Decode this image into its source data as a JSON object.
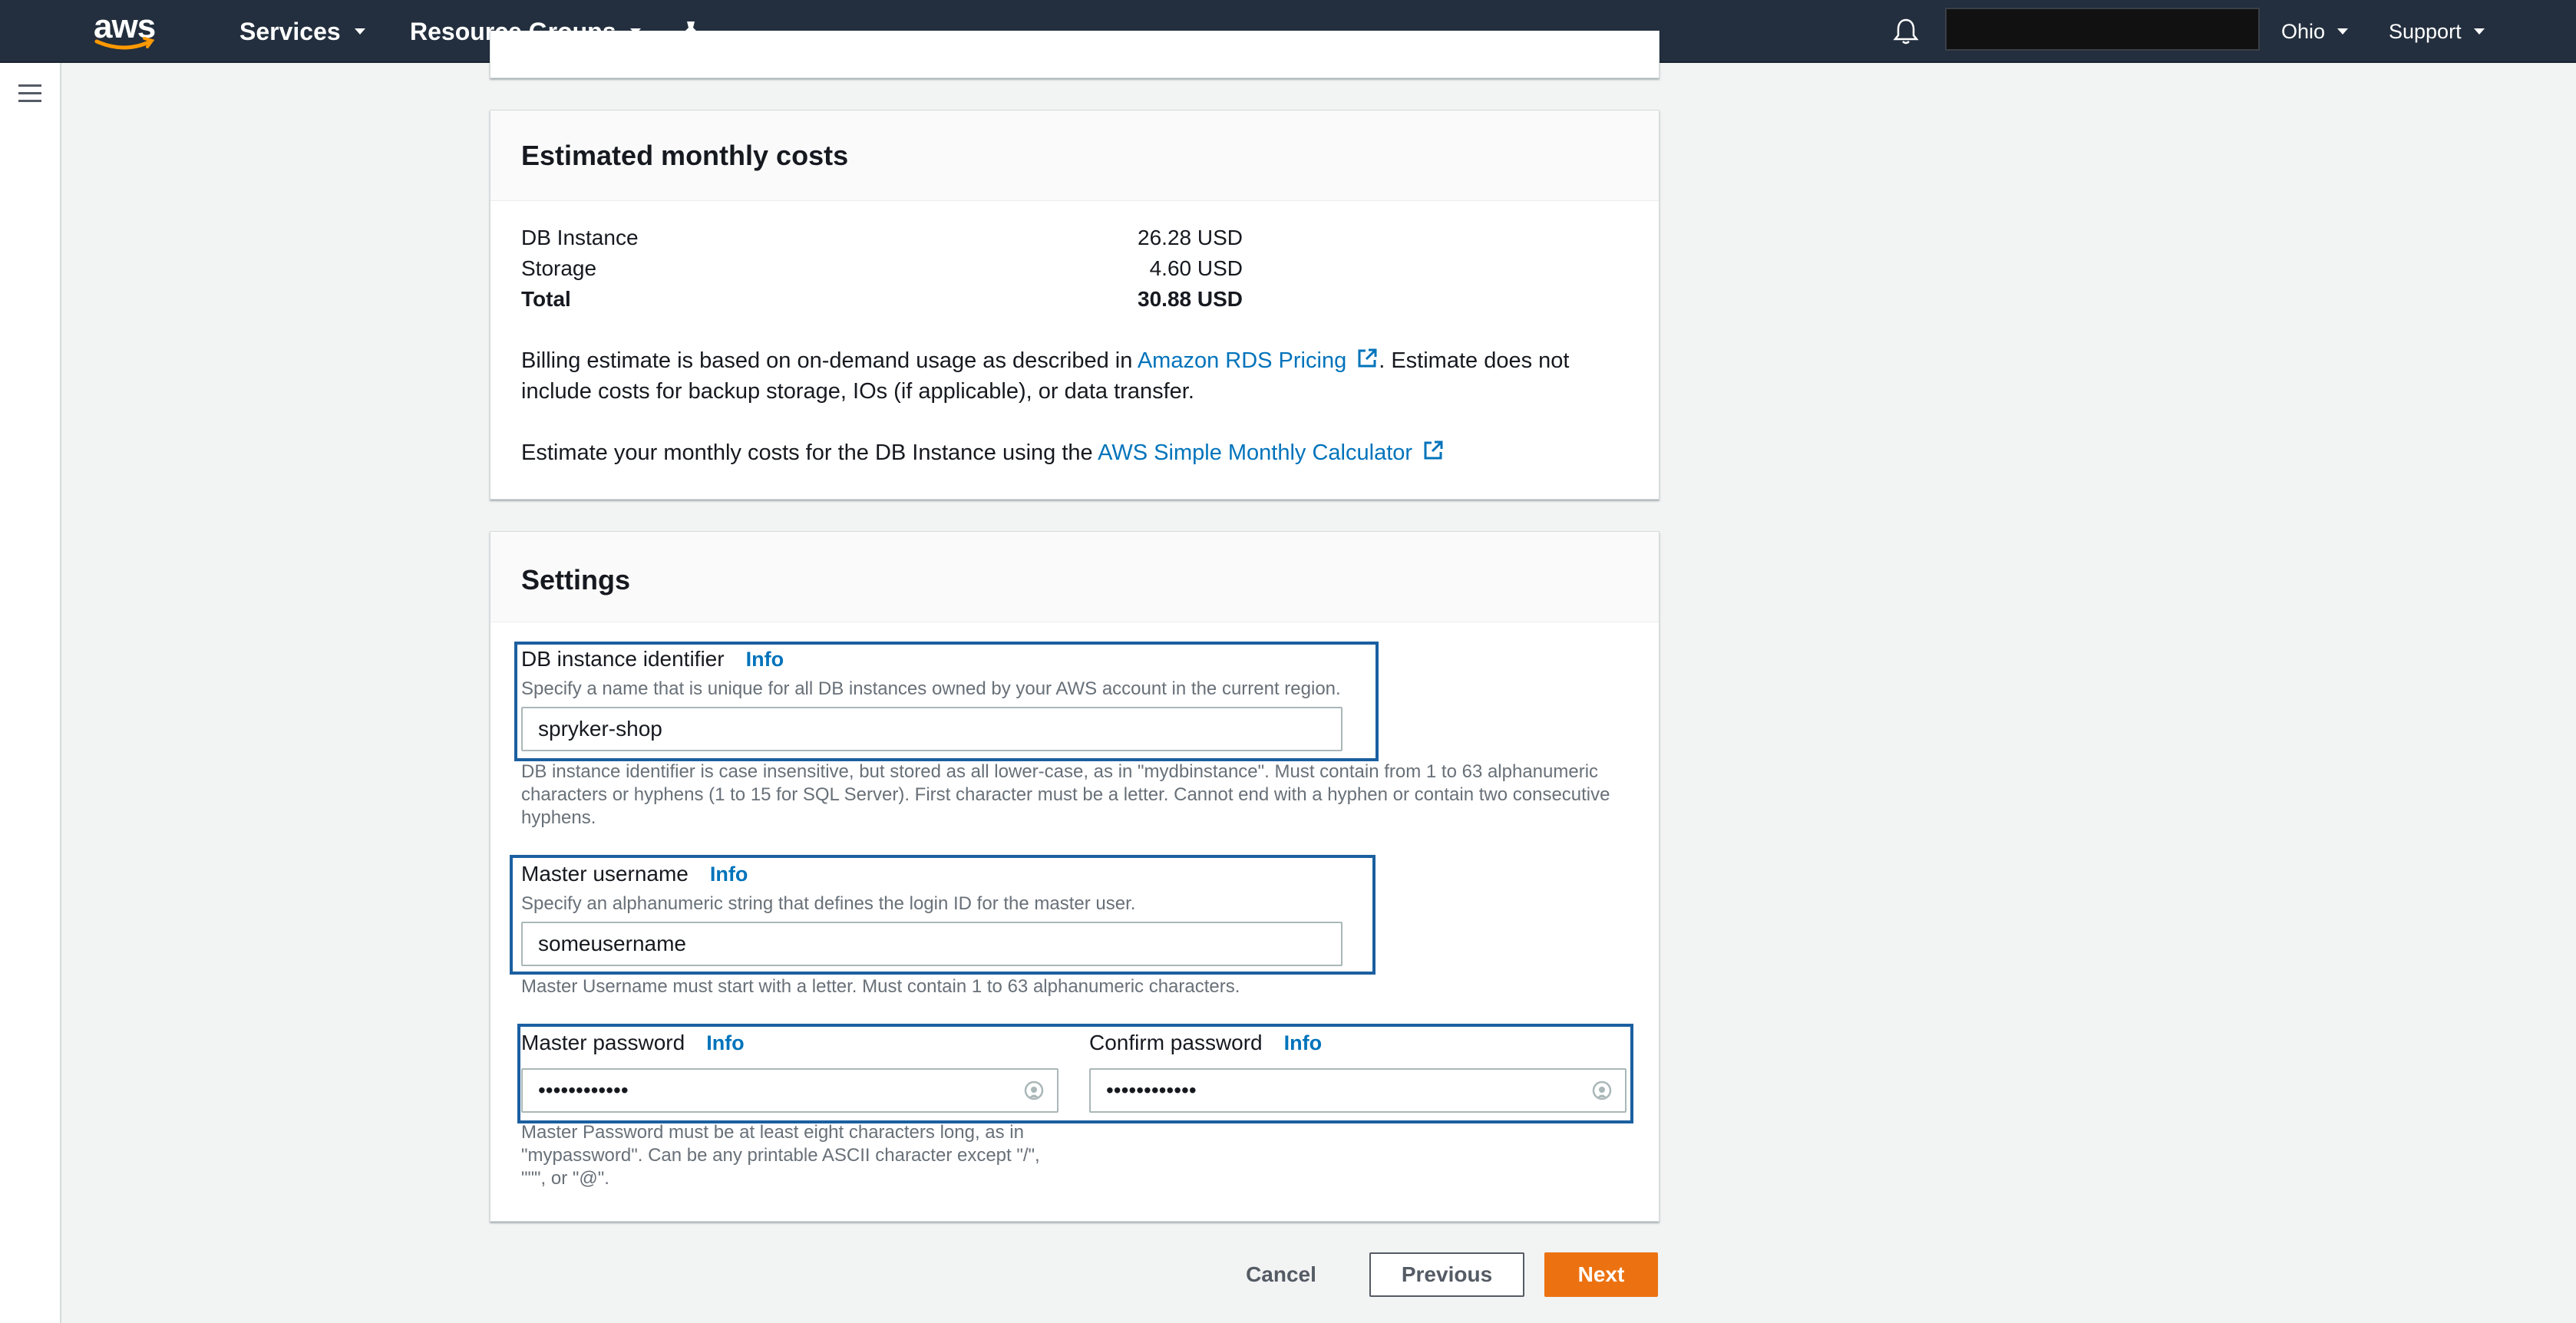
{
  "nav": {
    "logo_text": "aws",
    "services": "Services",
    "resource_groups": "Resource Groups",
    "region": "Ohio",
    "support": "Support"
  },
  "costs": {
    "title": "Estimated monthly costs",
    "rows": [
      {
        "label": "DB Instance",
        "value": "26.28 USD"
      },
      {
        "label": "Storage",
        "value": "4.60 USD"
      },
      {
        "label": "Total",
        "value": "30.88 USD"
      }
    ],
    "billing_prefix": "Billing estimate is based on on-demand usage as described in ",
    "billing_link": "Amazon RDS Pricing",
    "billing_suffix": ". Estimate does not include costs for backup storage, IOs (if applicable), or data transfer.",
    "calc_prefix": "Estimate your monthly costs for the DB Instance using the ",
    "calc_link": "AWS Simple Monthly Calculator"
  },
  "settings": {
    "title": "Settings",
    "info": "Info",
    "db_identifier": {
      "label": "DB instance identifier",
      "desc": "Specify a name that is unique for all DB instances owned by your AWS account in the current region.",
      "value": "spryker-shop",
      "help": "DB instance identifier is case insensitive, but stored as all lower-case, as in \"mydbinstance\". Must contain from 1 to 63 alphanumeric characters or hyphens (1 to 15 for SQL Server). First character must be a letter. Cannot end with a hyphen or contain two consecutive hyphens."
    },
    "master_username": {
      "label": "Master username",
      "desc": "Specify an alphanumeric string that defines the login ID for the master user.",
      "value": "someusername",
      "help": "Master Username must start with a letter. Must contain 1 to 63 alphanumeric characters."
    },
    "master_password": {
      "label": "Master password",
      "value": "••••••••••••",
      "help": "Master Password must be at least eight characters long, as in \"mypassword\". Can be any printable ASCII character except \"/\", \"\"\", or \"@\"."
    },
    "confirm_password": {
      "label": "Confirm password",
      "value": "••••••••••••"
    }
  },
  "actions": {
    "cancel": "Cancel",
    "previous": "Previous",
    "next": "Next"
  },
  "colors": {
    "nav_bg": "#232f3e",
    "link": "#0073bb",
    "highlight": "#1b5fa0",
    "primary": "#ec7211"
  }
}
